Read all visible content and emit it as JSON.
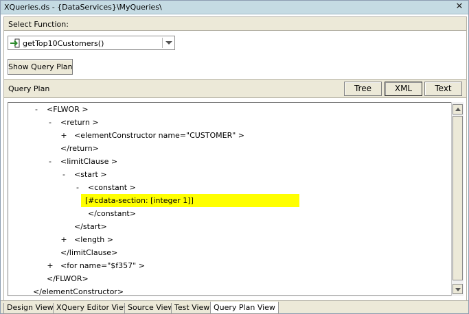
{
  "window": {
    "title": "XQueries.ds - {DataServices}\\MyQueries\\",
    "close_glyph": "✕"
  },
  "function_section": {
    "label": "Select Function:",
    "selected_function": "getTop10Customers()",
    "show_plan_label": "Show Query Plan"
  },
  "plan_section": {
    "label": "Query Plan",
    "view_buttons": [
      "Tree",
      "XML",
      "Text"
    ],
    "active_view": "XML"
  },
  "tree_lines": [
    {
      "toggle": "-",
      "text": "<FLWOR >",
      "depth": 1
    },
    {
      "toggle": "-",
      "text": "<return >",
      "depth": 2
    },
    {
      "toggle": "+",
      "text": "<elementConstructor name=\"CUSTOMER\" >",
      "depth": 3
    },
    {
      "toggle": "",
      "text": "</return>",
      "depth": 2
    },
    {
      "toggle": "-",
      "text": "<limitClause >",
      "depth": 2
    },
    {
      "toggle": "-",
      "text": "<start >",
      "depth": 3
    },
    {
      "toggle": "-",
      "text": "<constant >",
      "depth": 4
    },
    {
      "toggle": "",
      "text": "[#cdata-section: [integer 1]]",
      "depth": 5,
      "highlight": true
    },
    {
      "toggle": "",
      "text": "</constant>",
      "depth": 4
    },
    {
      "toggle": "",
      "text": "</start>",
      "depth": 3
    },
    {
      "toggle": "+",
      "text": "<length >",
      "depth": 3
    },
    {
      "toggle": "",
      "text": "</limitClause>",
      "depth": 2
    },
    {
      "toggle": "+",
      "text": "<for name=\"$f357\" >",
      "depth": 2
    },
    {
      "toggle": "",
      "text": "</FLWOR>",
      "depth": 1
    },
    {
      "toggle": "",
      "text": "</elementConstructor>",
      "depth": 0
    }
  ],
  "tabs": [
    "Design View",
    "XQuery Editor View",
    "Source View",
    "Test View",
    "Query Plan View"
  ],
  "active_tab": "Query Plan View",
  "colors": {
    "title_bar": "#c5dbe3",
    "panel": "#ece9d8",
    "highlight": "#ffff00",
    "function_icon": "#2e8b2e"
  },
  "icons": {
    "function_icon": "function-arrow-icon",
    "dropdown": "chevron-down-icon",
    "close": "close-icon"
  }
}
